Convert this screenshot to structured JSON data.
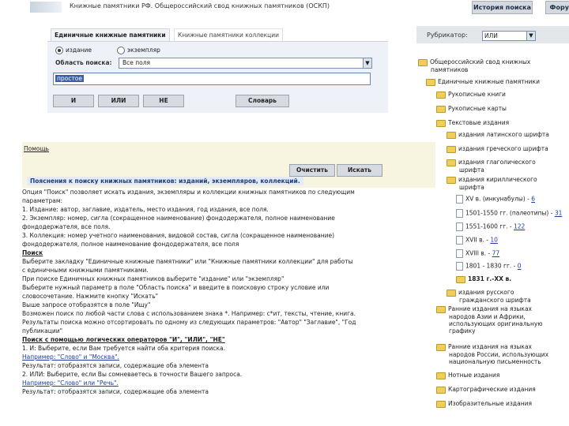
{
  "header": {
    "title": "Книжные памятники РФ. Общероссийский свод книжных памятников (ОСКП)",
    "history_button": "История поиска",
    "forum_button": "Форум"
  },
  "tabs": [
    "Единичные книжные памятники",
    "Книжные памятники коллекции"
  ],
  "search": {
    "radio_edition": "издание",
    "radio_copy": "экземпляр",
    "area_label": "Область поиска:",
    "area_value": "Все поля",
    "query": "простое",
    "buttons": {
      "and": "И",
      "or": "ИЛИ",
      "not": "НЕ",
      "dictionary": "Словарь"
    }
  },
  "filter": {
    "help_link": "Помощь",
    "clear": "Очистить",
    "search": "Искать"
  },
  "help": {
    "title": "Пояснения к поиску книжных памятников: изданий, экземпляров, коллекций.",
    "lines": [
      "Опция \"Поиск\" позволяет искать издания, экземпляры и коллекции книжных памятников по следующим",
      "параметрам:",
      "    1. Издание: автор, заглавие, издатель, место издания, год издания, все поля.",
      "    2. Экземпляр: номер, сигла (сокращенное наименование) фондодержателя, полное наименование",
      "фондодержателя, все поля.",
      "    3. Коллекция: номер учетного наименования, видовой состав, сигла (сокращенное наименование)",
      "фондодержателя, полное наименование фондодержателя, все поля",
      "Поиск",
      "Выберите закладку \"Единичные книжные памятники\" или \"Книжные памятники коллекции\" для работы",
      "с единичными книжными памятниками.",
      "При поиске Единичных книжных памятников выберите \"издание\" или \"экземпляр\"",
      "Выберите нужный параметр в поле \"Область поиска\" и введите в поисковую строку условие или",
      "словосочетание. Нажмите кнопку \"Искать\"",
      "Выше запросе отобразятся в поле \"Ищу\"",
      "Возможен поиск по любой части слова с использованием знака *. Например: с*ит, тексты, чтение, книга.",
      "Результаты поиска можно отсортировать по одному из следующих параметров: \"Автор\" \"Заглавие\", \"Год",
      "публикации\"",
      "Поиск с помощью логических операторов \"И\", \"ИЛИ\", \"НЕ\"",
      "1. И: Выберите, если Вам требуется найти оба критерия поиска.",
      "Например: \"Слово\" и \"Москва\".",
      "Результат: отобразятся записи, содержащие оба элемента",
      "2. ИЛИ: Выберите, если Вы сомневаетесь в точности Вашего запроса.",
      "Например: \"Слово\" или \"Речь\".",
      "Результат: отобразятся записи, содержащие оба элемента"
    ]
  },
  "rubricator": {
    "label": "Рубрикатор:",
    "select_value": "ИЛИ",
    "tree": [
      {
        "label": "Общероссийский свод книжных",
        "label2": "памятников",
        "icon": "folder"
      },
      {
        "label": "Единичные книжные памятники",
        "icon": "folder"
      },
      {
        "label": "Рукописные книги",
        "icon": "folder"
      },
      {
        "label": "Рукописные карты",
        "icon": "folder"
      },
      {
        "label": "Текстовые издания",
        "icon": "folder"
      },
      {
        "label": "издания латинского шрифта",
        "icon": "folder"
      },
      {
        "label": "издания греческого шрифта",
        "icon": "folder"
      },
      {
        "label": "издания глаголического",
        "label2": "шрифта",
        "icon": "folder"
      },
      {
        "label": "издания кириллического",
        "label2": "шрифта",
        "icon": "folder"
      },
      {
        "label": "XV в. (инкунабулы) - ",
        "count": "6",
        "icon": "doc"
      },
      {
        "label": "1501-1550 гг. (палеотипы) - ",
        "count": "31",
        "icon": "doc"
      },
      {
        "label": "1551-1600 гг. - ",
        "count": "122",
        "icon": "doc"
      },
      {
        "label": "XVII в. - ",
        "count": "10",
        "icon": "doc"
      },
      {
        "label": "XVIII в. - ",
        "count": "77",
        "icon": "doc"
      },
      {
        "label": "1801 - 1830 гг. - ",
        "count": "0",
        "icon": "doc"
      },
      {
        "label": "1831 г.-XX в.",
        "icon": "folder"
      },
      {
        "label": "издания русского",
        "label2": "гражданского шрифта",
        "icon": "folder"
      },
      {
        "label": "Ранние издания на языках",
        "label2": "народов Азии и Африки,",
        "label3": "использующих оригинальную",
        "label4": "графику",
        "icon": "folder"
      },
      {
        "label": "Ранние издания на языках",
        "label2": "народов России, использующих",
        "label3": "национальную письменность",
        "icon": "folder"
      },
      {
        "label": "Нотные издания",
        "icon": "folder"
      },
      {
        "label": "Картографические издания",
        "icon": "folder"
      },
      {
        "label": "Изобразительные издания",
        "icon": "folder"
      }
    ]
  }
}
